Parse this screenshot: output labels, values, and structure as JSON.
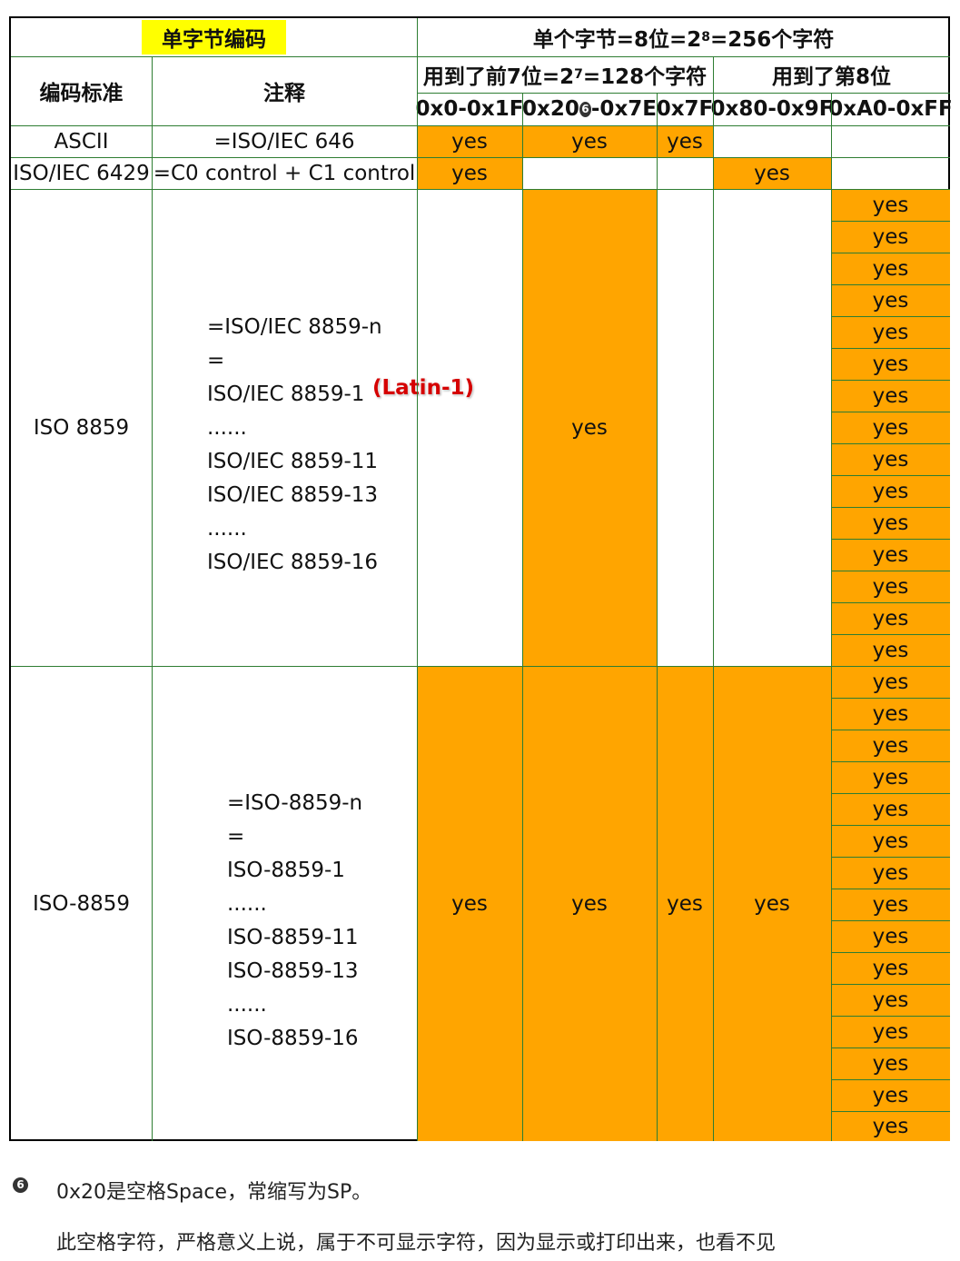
{
  "header": {
    "group_title": "单字节编码",
    "bytes_title_pre": "单个字节=8位=2",
    "bytes_title_exp": "8",
    "bytes_title_post": "=256个字符",
    "seven_bit_pre": "用到了前7位=2",
    "seven_bit_exp": "7",
    "seven_bit_post": "=128个字符",
    "eighth_bit": "用到了第8位",
    "col_standard": "编码标准",
    "col_note": "注释",
    "ranges": [
      "0x0-0x1F",
      "0x20",
      "-0x7E",
      "0x7F",
      "0x80-0x9F",
      "0xA0-0xFF"
    ]
  },
  "rows": {
    "ascii": {
      "name": "ASCII",
      "note": "=ISO/IEC 646"
    },
    "iso6429": {
      "name": "ISO/IEC 6429",
      "note": "=C0 control + C1 control"
    },
    "iso8859": {
      "name": "ISO 8859",
      "notes": [
        "=ISO/IEC 8859-n",
        "=",
        "ISO/IEC 8859-1",
        "......",
        "ISO/IEC 8859-11",
        "ISO/IEC 8859-13",
        "......",
        "ISO/IEC 8859-16"
      ],
      "latin_label": "(Latin-1)"
    },
    "iso8859dash": {
      "name": "ISO-8859",
      "notes": [
        "=ISO-8859-n",
        "=",
        "ISO-8859-1",
        "......",
        "ISO-8859-11",
        "ISO-8859-13",
        "......",
        "ISO-8859-16"
      ]
    }
  },
  "yes_label": "yes",
  "marker": "6",
  "footnote": {
    "line1": "0x20是空格Space，常缩写为SP。",
    "line2": "此空格字符，严格意义上说，属于不可显示字符，因为显示或打印出来，也看不见"
  },
  "colors": {
    "highlight": "#FFFF00",
    "yes_fill": "#FFA500",
    "grid": "#2e7d32",
    "latin": "#d50000"
  }
}
